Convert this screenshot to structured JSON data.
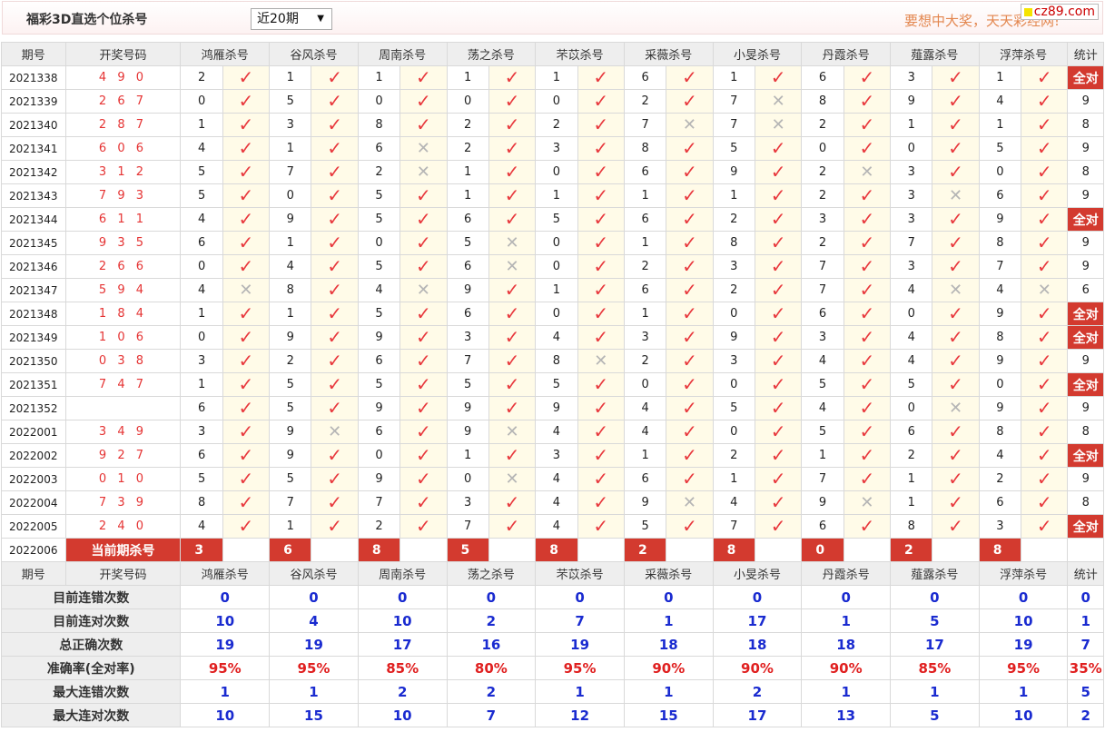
{
  "header": {
    "title": "福彩3D直选个位杀号",
    "range_select": "近20期",
    "slogan": "要想中大奖，天天彩经网!",
    "site_badge": "cz89.com"
  },
  "columns": [
    "期号",
    "开奖号码",
    "鸿雁杀号",
    "谷风杀号",
    "周南杀号",
    "荡之杀号",
    "芣苡杀号",
    "采薇杀号",
    "小旻杀号",
    "丹霞杀号",
    "薤露杀号",
    "浮萍杀号",
    "统计"
  ],
  "all_correct_label": "全对",
  "rows": [
    {
      "period": "2021338",
      "nums": "4 9 0",
      "kills": [
        "2",
        "1",
        "1",
        "1",
        "1",
        "6",
        "1",
        "6",
        "3",
        "1"
      ],
      "hits": [
        1,
        1,
        1,
        1,
        1,
        1,
        1,
        1,
        1,
        1
      ],
      "stat": "全对"
    },
    {
      "period": "2021339",
      "nums": "2 6 7",
      "kills": [
        "0",
        "5",
        "0",
        "0",
        "0",
        "2",
        "7",
        "8",
        "9",
        "4"
      ],
      "hits": [
        1,
        1,
        1,
        1,
        1,
        1,
        0,
        1,
        1,
        1
      ],
      "stat": "9"
    },
    {
      "period": "2021340",
      "nums": "2 8 7",
      "kills": [
        "1",
        "3",
        "8",
        "2",
        "2",
        "7",
        "7",
        "2",
        "1",
        "1"
      ],
      "hits": [
        1,
        1,
        1,
        1,
        1,
        0,
        0,
        1,
        1,
        1
      ],
      "stat": "8"
    },
    {
      "period": "2021341",
      "nums": "6 0 6",
      "kills": [
        "4",
        "1",
        "6",
        "2",
        "3",
        "8",
        "5",
        "0",
        "0",
        "5"
      ],
      "hits": [
        1,
        1,
        0,
        1,
        1,
        1,
        1,
        1,
        1,
        1
      ],
      "stat": "9"
    },
    {
      "period": "2021342",
      "nums": "3 1 2",
      "kills": [
        "5",
        "7",
        "2",
        "1",
        "0",
        "6",
        "9",
        "2",
        "3",
        "0"
      ],
      "hits": [
        1,
        1,
        0,
        1,
        1,
        1,
        1,
        0,
        1,
        1
      ],
      "stat": "8"
    },
    {
      "period": "2021343",
      "nums": "7 9 3",
      "kills": [
        "5",
        "0",
        "5",
        "1",
        "1",
        "1",
        "1",
        "2",
        "3",
        "6"
      ],
      "hits": [
        1,
        1,
        1,
        1,
        1,
        1,
        1,
        1,
        0,
        1
      ],
      "stat": "9"
    },
    {
      "period": "2021344",
      "nums": "6 1 1",
      "kills": [
        "4",
        "9",
        "5",
        "6",
        "5",
        "6",
        "2",
        "3",
        "3",
        "9"
      ],
      "hits": [
        1,
        1,
        1,
        1,
        1,
        1,
        1,
        1,
        1,
        1
      ],
      "stat": "全对"
    },
    {
      "period": "2021345",
      "nums": "9 3 5",
      "kills": [
        "6",
        "1",
        "0",
        "5",
        "0",
        "1",
        "8",
        "2",
        "7",
        "8"
      ],
      "hits": [
        1,
        1,
        1,
        0,
        1,
        1,
        1,
        1,
        1,
        1
      ],
      "stat": "9"
    },
    {
      "period": "2021346",
      "nums": "2 6 6",
      "kills": [
        "0",
        "4",
        "5",
        "6",
        "0",
        "2",
        "3",
        "7",
        "3",
        "7"
      ],
      "hits": [
        1,
        1,
        1,
        0,
        1,
        1,
        1,
        1,
        1,
        1
      ],
      "stat": "9"
    },
    {
      "period": "2021347",
      "nums": "5 9 4",
      "kills": [
        "4",
        "8",
        "4",
        "9",
        "1",
        "6",
        "2",
        "7",
        "4",
        "4"
      ],
      "hits": [
        0,
        1,
        0,
        1,
        1,
        1,
        1,
        1,
        0,
        0
      ],
      "stat": "6"
    },
    {
      "period": "2021348",
      "nums": "1 8 4",
      "kills": [
        "1",
        "1",
        "5",
        "6",
        "0",
        "1",
        "0",
        "6",
        "0",
        "9"
      ],
      "hits": [
        1,
        1,
        1,
        1,
        1,
        1,
        1,
        1,
        1,
        1
      ],
      "stat": "全对"
    },
    {
      "period": "2021349",
      "nums": "1 0 6",
      "kills": [
        "0",
        "9",
        "9",
        "3",
        "4",
        "3",
        "9",
        "3",
        "4",
        "8"
      ],
      "hits": [
        1,
        1,
        1,
        1,
        1,
        1,
        1,
        1,
        1,
        1
      ],
      "stat": "全对"
    },
    {
      "period": "2021350",
      "nums": "0 3 8",
      "kills": [
        "3",
        "2",
        "6",
        "7",
        "8",
        "2",
        "3",
        "4",
        "4",
        "9"
      ],
      "hits": [
        1,
        1,
        1,
        1,
        0,
        1,
        1,
        1,
        1,
        1
      ],
      "stat": "9"
    },
    {
      "period": "2021351",
      "nums": "7 4 7",
      "kills": [
        "1",
        "5",
        "5",
        "5",
        "5",
        "0",
        "0",
        "5",
        "5",
        "0"
      ],
      "hits": [
        1,
        1,
        1,
        1,
        1,
        1,
        1,
        1,
        1,
        1
      ],
      "stat": "全对"
    },
    {
      "period": "2021352",
      "nums": "",
      "kills": [
        "6",
        "5",
        "9",
        "9",
        "9",
        "4",
        "5",
        "4",
        "0",
        "9"
      ],
      "hits": [
        1,
        1,
        1,
        1,
        1,
        1,
        1,
        1,
        0,
        1
      ],
      "stat": "9"
    },
    {
      "period": "2022001",
      "nums": "3 4 9",
      "kills": [
        "3",
        "9",
        "6",
        "9",
        "4",
        "4",
        "0",
        "5",
        "6",
        "8"
      ],
      "hits": [
        1,
        0,
        1,
        0,
        1,
        1,
        1,
        1,
        1,
        1
      ],
      "stat": "8"
    },
    {
      "period": "2022002",
      "nums": "9 2 7",
      "kills": [
        "6",
        "9",
        "0",
        "1",
        "3",
        "1",
        "2",
        "1",
        "2",
        "4"
      ],
      "hits": [
        1,
        1,
        1,
        1,
        1,
        1,
        1,
        1,
        1,
        1
      ],
      "stat": "全对"
    },
    {
      "period": "2022003",
      "nums": "0 1 0",
      "kills": [
        "5",
        "5",
        "9",
        "0",
        "4",
        "6",
        "1",
        "7",
        "1",
        "2"
      ],
      "hits": [
        1,
        1,
        1,
        0,
        1,
        1,
        1,
        1,
        1,
        1
      ],
      "stat": "9"
    },
    {
      "period": "2022004",
      "nums": "7 3 9",
      "kills": [
        "8",
        "7",
        "7",
        "3",
        "4",
        "9",
        "4",
        "9",
        "1",
        "6"
      ],
      "hits": [
        1,
        1,
        1,
        1,
        1,
        0,
        1,
        0,
        1,
        1
      ],
      "stat": "8"
    },
    {
      "period": "2022005",
      "nums": "2 4 0",
      "kills": [
        "4",
        "1",
        "2",
        "7",
        "4",
        "5",
        "7",
        "6",
        "8",
        "3"
      ],
      "hits": [
        1,
        1,
        1,
        1,
        1,
        1,
        1,
        1,
        1,
        1
      ],
      "stat": "全对"
    }
  ],
  "current": {
    "period": "2022006",
    "label": "当前期杀号",
    "kills": [
      "3",
      "6",
      "8",
      "5",
      "8",
      "2",
      "8",
      "0",
      "2",
      "8"
    ]
  },
  "stats": [
    {
      "label": "目前连错次数",
      "color": "blue",
      "values": [
        "0",
        "0",
        "0",
        "0",
        "0",
        "0",
        "0",
        "0",
        "0",
        "0",
        "0"
      ]
    },
    {
      "label": "目前连对次数",
      "color": "blue",
      "values": [
        "10",
        "4",
        "10",
        "2",
        "7",
        "1",
        "17",
        "1",
        "5",
        "10",
        "1"
      ]
    },
    {
      "label": "总正确次数",
      "color": "blue",
      "values": [
        "19",
        "19",
        "17",
        "16",
        "19",
        "18",
        "18",
        "18",
        "17",
        "19",
        "7"
      ]
    },
    {
      "label": "准确率(全对率)",
      "color": "red",
      "values": [
        "95%",
        "95%",
        "85%",
        "80%",
        "95%",
        "90%",
        "90%",
        "90%",
        "85%",
        "95%",
        "35%"
      ]
    },
    {
      "label": "最大连错次数",
      "color": "blue",
      "values": [
        "1",
        "1",
        "2",
        "2",
        "1",
        "1",
        "2",
        "1",
        "1",
        "1",
        "5"
      ]
    },
    {
      "label": "最大连对次数",
      "color": "blue",
      "values": [
        "10",
        "15",
        "10",
        "7",
        "12",
        "15",
        "17",
        "13",
        "5",
        "10",
        "2"
      ]
    }
  ],
  "icons": {
    "hit": "check-icon",
    "miss": "cross-icon"
  },
  "colors": {
    "accent": "#d33a2f",
    "check": "#e8383d",
    "blue": "#1a2bd0"
  }
}
